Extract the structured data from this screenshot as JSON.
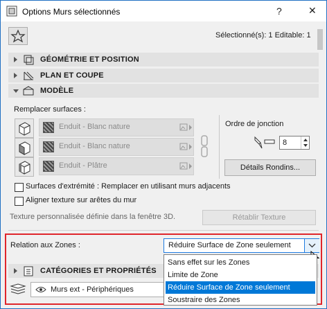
{
  "window": {
    "title": "Options Murs sélectionnés",
    "help_label": "?",
    "close_label": "✕"
  },
  "header": {
    "selection_info": "Sélectionné(s): 1 Editable: 1"
  },
  "sections": {
    "geometry": "GÉOMÉTRIE ET POSITION",
    "plan": "PLAN ET COUPE",
    "model": "MODÈLE",
    "categories": "CATÉGORIES ET PROPRIÉTÉS"
  },
  "model": {
    "override_label": "Remplacer surfaces :",
    "surfaces": [
      "Enduit - Blanc nature",
      "Enduit - Blanc nature",
      "Enduit - Plâtre"
    ],
    "junction_label": "Ordre de jonction",
    "junction_value": "8",
    "details_button": "Détails Rondins...",
    "checkbox_end_surfaces": "Surfaces d'extrémité : Remplacer en utilisant murs adjacents",
    "checkbox_align_texture": "Aligner texture sur arêtes du mur",
    "custom_texture_text": "Texture personnalisée définie dans la fenêtre 3D.",
    "reset_texture_button": "Rétablir Texture"
  },
  "zones": {
    "label": "Relation aux Zones :",
    "selected": "Réduire Surface de Zone seulement",
    "options": [
      "Sans effet sur les Zones",
      "Limite de Zone",
      "Réduire Surface de Zone seulement",
      "Soustraire des Zones"
    ]
  },
  "footer": {
    "layer_name": "Murs ext - Périphériques"
  },
  "colors": {
    "accent": "#1e7be0",
    "highlight": "#0078d7",
    "frame": "#e0252b"
  }
}
